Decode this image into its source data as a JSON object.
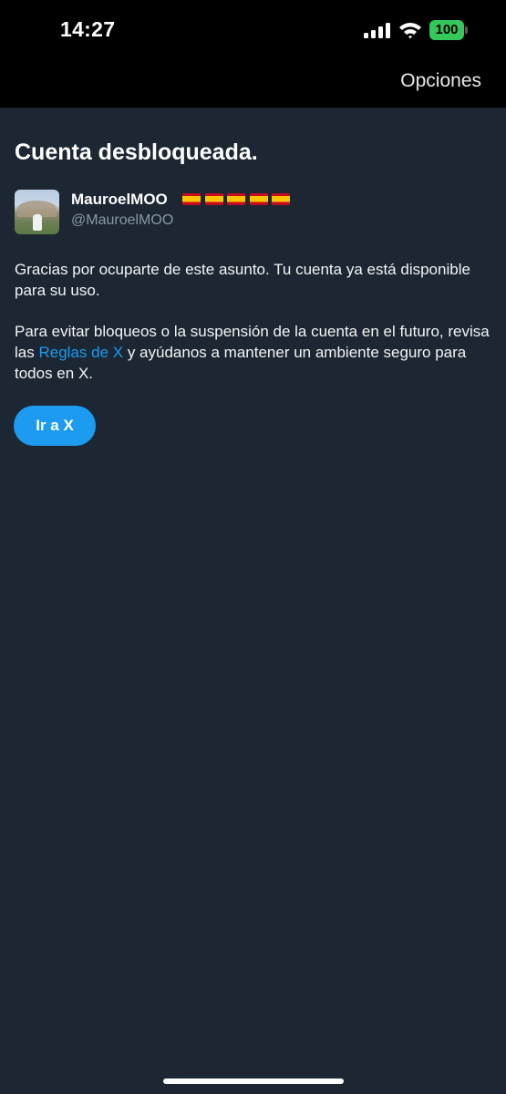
{
  "status_bar": {
    "time": "14:27",
    "battery": "100",
    "icons": [
      "signal-icon",
      "wifi-icon",
      "battery-icon"
    ]
  },
  "header": {
    "options_label": "Opciones"
  },
  "main": {
    "title": "Cuenta desbloqueada.",
    "user": {
      "name": "MauroelMOO",
      "handle": "@MauroelMOO",
      "flags_count": 5
    },
    "paragraph1": "Gracias por ocuparte de este asunto. Tu cuenta ya está disponible para su uso.",
    "paragraph2": {
      "before": "Para evitar bloqueos o la suspensión de la cuenta en el futuro, revisa las ",
      "link": "Reglas de X",
      "after": " y ayúdanos a mantener un ambiente seguro para todos en X."
    },
    "button_label": "Ir a X"
  },
  "colors": {
    "background": "#1c2733",
    "accent": "#1d9bf0",
    "secondary_text": "#8b98a5",
    "battery": "#34c759"
  }
}
